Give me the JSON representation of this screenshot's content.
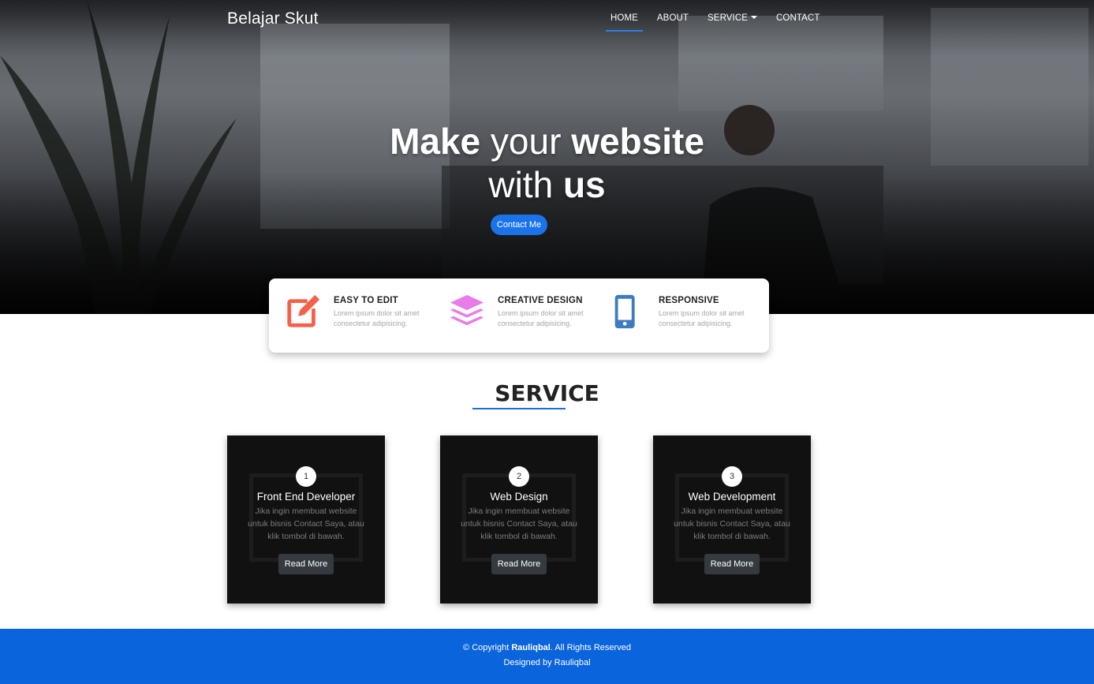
{
  "navbar": {
    "brand": "Belajar Skut",
    "links": [
      {
        "label": "HOME",
        "active": true
      },
      {
        "label": "ABOUT",
        "active": false
      },
      {
        "label": "SERVICE",
        "active": false,
        "dropdown": true
      },
      {
        "label": "CONTACT",
        "active": false
      }
    ]
  },
  "hero": {
    "line1": {
      "a": "Make",
      "b": "your",
      "c": "website"
    },
    "line2": {
      "a": "with",
      "b": "us"
    },
    "cta_label": "Contact Me"
  },
  "features": [
    {
      "icon": "edit-icon",
      "title": "EASY TO EDIT",
      "desc": "Lorem ipsum dolor sit amet consectetur adipisicing.",
      "color": "#f4614a"
    },
    {
      "icon": "layers-icon",
      "title": "CREATIVE DESIGN",
      "desc": "Lorem ipsum dolor sit amet consectetur adipisicing.",
      "color": "#e87ce8"
    },
    {
      "icon": "mobile-icon",
      "title": "RESPONSIVE",
      "desc": "Lorem ipsum dolor sit amet consectetur adipisicing.",
      "color": "#3d7cbf"
    }
  ],
  "service": {
    "title": "SERVICE",
    "cards": [
      {
        "number": "1",
        "title": "Front End Developer",
        "desc": "Jika ingin membuat website untuk bisnis Contact Saya, atau klik tombol di bawah.",
        "button": "Read More"
      },
      {
        "number": "2",
        "title": "Web Design",
        "desc": "Jika ingin membuat website untuk bisnis Contact Saya, atau klik tombol di bawah.",
        "button": "Read More"
      },
      {
        "number": "3",
        "title": "Web Development",
        "desc": "Jika ingin membuat website untuk bisnis Contact Saya, atau klik tombol di bawah.",
        "button": "Read More"
      }
    ]
  },
  "footer": {
    "copyright_prefix": "© Copyright ",
    "owner": "Rauliqbal",
    "copyright_suffix": ". All Rights Reserved",
    "designed": "Designed by Rauliqbal"
  },
  "colors": {
    "accent": "#1a73e8",
    "footer": "#0a64dc"
  }
}
